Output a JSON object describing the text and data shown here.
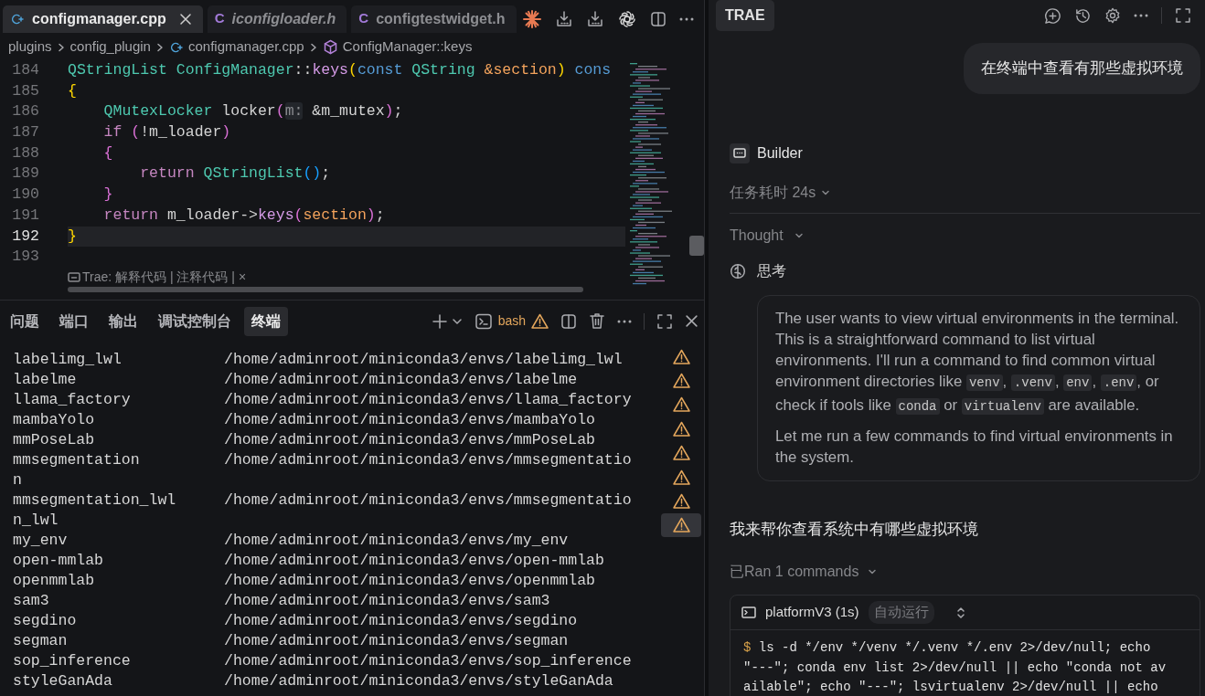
{
  "editor_tabs": [
    {
      "label": "configmanager.cpp",
      "kind": "cpp",
      "selected": true,
      "preview": false
    },
    {
      "label": "iconfigloader.h",
      "kind": "header",
      "icon_text": "C",
      "selected": false,
      "preview": true
    },
    {
      "label": "configtestwidget.h",
      "kind": "header",
      "icon_text": "C",
      "selected": false,
      "preview": false
    }
  ],
  "breadcrumb": [
    {
      "label": "plugins",
      "kind": "folder"
    },
    {
      "label": "config_plugin",
      "kind": "folder"
    },
    {
      "label": "configmanager.cpp",
      "kind": "cpp"
    },
    {
      "label": "ConfigManager::keys",
      "kind": "symbol"
    }
  ],
  "code_lines": [
    {
      "number": "184",
      "current": false,
      "tokens": [
        {
          "text": "QStringList ",
          "kind": "type"
        },
        {
          "text": "ConfigManager",
          "kind": "type"
        },
        {
          "text": "::",
          "kind": "plain"
        },
        {
          "text": "keys",
          "kind": "fn"
        },
        {
          "text": "(",
          "kind": "bracket1"
        },
        {
          "text": "const ",
          "kind": "kw"
        },
        {
          "text": "QString ",
          "kind": "type"
        },
        {
          "text": "&section",
          "kind": "param"
        },
        {
          "text": ") ",
          "kind": "bracket1"
        },
        {
          "text": "cons",
          "kind": "kw"
        }
      ]
    },
    {
      "number": "185",
      "current": false,
      "tokens": [
        {
          "text": "{",
          "kind": "bracket1"
        }
      ]
    },
    {
      "number": "186",
      "current": false,
      "tokens": [
        {
          "text": "    QMutexLocker",
          "kind": "type"
        },
        {
          "text": " locker",
          "kind": "plain"
        },
        {
          "text": "(",
          "kind": "bracket2"
        },
        {
          "text": "m:",
          "kind": "hint"
        },
        {
          "text": " &m_mutex",
          "kind": "plain"
        },
        {
          "text": ")",
          "kind": "bracket2"
        },
        {
          "text": ";",
          "kind": "plain"
        }
      ]
    },
    {
      "number": "187",
      "current": false,
      "tokens": [
        {
          "text": "    if ",
          "kind": "ctl"
        },
        {
          "text": "(",
          "kind": "bracket2"
        },
        {
          "text": "!m_loader",
          "kind": "plain"
        },
        {
          "text": ")",
          "kind": "bracket2"
        }
      ]
    },
    {
      "number": "188",
      "current": false,
      "tokens": [
        {
          "text": "    {",
          "kind": "bracket2"
        }
      ]
    },
    {
      "number": "189",
      "current": false,
      "tokens": [
        {
          "text": "        return ",
          "kind": "ctl"
        },
        {
          "text": "QStringList",
          "kind": "type"
        },
        {
          "text": "(",
          "kind": "bracket3"
        },
        {
          "text": ")",
          "kind": "bracket3"
        },
        {
          "text": ";",
          "kind": "plain"
        }
      ]
    },
    {
      "number": "190",
      "current": false,
      "tokens": [
        {
          "text": "    }",
          "kind": "bracket2"
        }
      ]
    },
    {
      "number": "191",
      "current": false,
      "tokens": [
        {
          "text": "    return",
          "kind": "ctl"
        },
        {
          "text": " m_loader->",
          "kind": "plain"
        },
        {
          "text": "keys",
          "kind": "fn"
        },
        {
          "text": "(",
          "kind": "bracket2"
        },
        {
          "text": "section",
          "kind": "param"
        },
        {
          "text": ")",
          "kind": "bracket2"
        },
        {
          "text": ";",
          "kind": "plain"
        }
      ]
    },
    {
      "number": "192",
      "current": true,
      "tokens": [
        {
          "text": "}",
          "kind": "bracket1"
        }
      ]
    },
    {
      "number": "193",
      "current": false
    }
  ],
  "inline_hint": "Trae: 解释代码 | 注释代码 | ×",
  "panel_tabs": [
    {
      "label": "问题",
      "selected": false
    },
    {
      "label": "端口",
      "selected": false
    },
    {
      "label": "输出",
      "selected": false
    },
    {
      "label": "调试控制台",
      "selected": false
    },
    {
      "label": "终端",
      "selected": true
    }
  ],
  "terminal_profile": "bash",
  "terminal_lines": [
    {
      "name": "labelimg_lwl",
      "path": "/home/adminroot/miniconda3/envs/labelimg_lwl"
    },
    {
      "name": "labelme",
      "path": "/home/adminroot/miniconda3/envs/labelme"
    },
    {
      "name": "llama_factory",
      "path": "/home/adminroot/miniconda3/envs/llama_factory"
    },
    {
      "name": "mambaYolo",
      "path": "/home/adminroot/miniconda3/envs/mambaYolo"
    },
    {
      "name": "mmPoseLab",
      "path": "/home/adminroot/miniconda3/envs/mmPoseLab"
    },
    {
      "name": "mmsegmentation",
      "path": "/home/adminroot/miniconda3/envs/mmsegmentatio"
    },
    {
      "name": "n"
    },
    {
      "name": "mmsegmentation_lwl",
      "path": "/home/adminroot/miniconda3/envs/mmsegmentatio"
    },
    {
      "name": "n_lwl"
    },
    {
      "name": "my_env",
      "path": "/home/adminroot/miniconda3/envs/my_env"
    },
    {
      "name": "open-mmlab",
      "path": "/home/adminroot/miniconda3/envs/open-mmlab"
    },
    {
      "name": "openmmlab",
      "path": "/home/adminroot/miniconda3/envs/openmmlab"
    },
    {
      "name": "sam3",
      "path": "/home/adminroot/miniconda3/envs/sam3"
    },
    {
      "name": "segdino",
      "path": "/home/adminroot/miniconda3/envs/segdino"
    },
    {
      "name": "segman",
      "path": "/home/adminroot/miniconda3/envs/segman"
    },
    {
      "name": "sop_inference",
      "path": "/home/adminroot/miniconda3/envs/sop_inference"
    },
    {
      "name": "styleGanAda",
      "path": "/home/adminroot/miniconda3/envs/styleGanAda"
    }
  ],
  "terminal_sessions": [
    {
      "selected": false
    },
    {
      "selected": false
    },
    {
      "selected": false
    },
    {
      "selected": false
    },
    {
      "selected": false
    },
    {
      "selected": false
    },
    {
      "selected": false
    },
    {
      "selected": true
    }
  ],
  "assistant": {
    "title": "TRAE",
    "user_message": "在终端中查看有那些虚拟环境",
    "agent": "Builder",
    "duration": "任务耗时 24s",
    "thought_label": "Thought",
    "thinking_label": "思考",
    "thought_paragraphs": [
      [
        {
          "kind": "text",
          "text": "The user wants to view virtual environments in the terminal. This is a straightforward command to list virtual environments. I'll run a command to find common virtual environment directories like "
        },
        {
          "kind": "code",
          "text": "venv"
        },
        {
          "kind": "text",
          "text": ", "
        },
        {
          "kind": "code",
          "text": ".venv"
        },
        {
          "kind": "text",
          "text": ", "
        },
        {
          "kind": "code",
          "text": "env"
        },
        {
          "kind": "text",
          "text": ", "
        },
        {
          "kind": "code",
          "text": ".env"
        },
        {
          "kind": "text",
          "text": ", or check if tools like "
        },
        {
          "kind": "code",
          "text": "conda"
        },
        {
          "kind": "text",
          "text": " or "
        },
        {
          "kind": "code",
          "text": "virtualenv"
        },
        {
          "kind": "text",
          "text": " are available."
        }
      ],
      [
        {
          "kind": "text",
          "text": "Let me run a few commands to find virtual environments in the system."
        }
      ]
    ],
    "reply": "我来帮你查看系统中有哪些虚拟环境",
    "ran_label": "已Ran 1 commands",
    "command": {
      "title": "platformV3 (1s)",
      "badge": "自动运行",
      "prompt": "$",
      "text": "ls -d */env */venv */.venv */.env 2>/dev/null; echo \"---\"; conda env list 2>/dev/null || echo \"conda not available\"; echo \"---\"; lsvirtualenv 2>/dev/null || echo"
    }
  }
}
